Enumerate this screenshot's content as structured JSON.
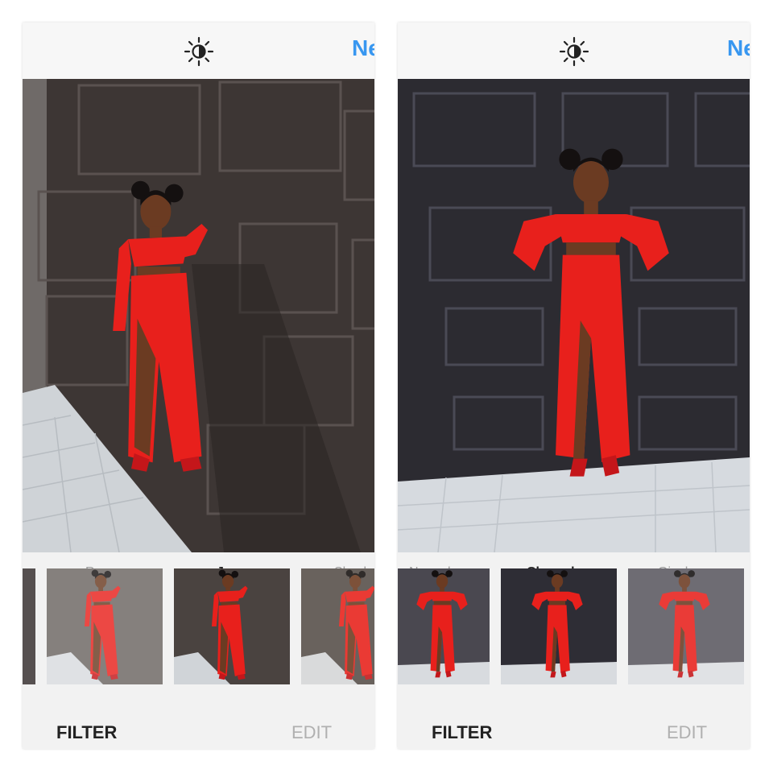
{
  "left_panel": {
    "next_label": "Ne",
    "filters": [
      {
        "label": "Reyes",
        "active": false
      },
      {
        "label": "Juno",
        "active": true
      },
      {
        "label": "Slumb",
        "active": false
      }
    ],
    "tabs": {
      "filter": "FILTER",
      "edit": "EDIT"
    }
  },
  "right_panel": {
    "next_label": "Ne",
    "filters": [
      {
        "label": "Normal",
        "active": false
      },
      {
        "label": "Clarendon",
        "active": true
      },
      {
        "label": "Gingham",
        "active": false
      }
    ],
    "tabs": {
      "filter": "FILTER",
      "edit": "EDIT"
    }
  },
  "icons": {
    "lux": "sun-half-icon"
  },
  "colors": {
    "accent_blue": "#3897f0",
    "outfit_red": "#e8201c",
    "garage_door": "#3a3636",
    "active_text": "#222222",
    "inactive_text": "#9a9a9a"
  }
}
